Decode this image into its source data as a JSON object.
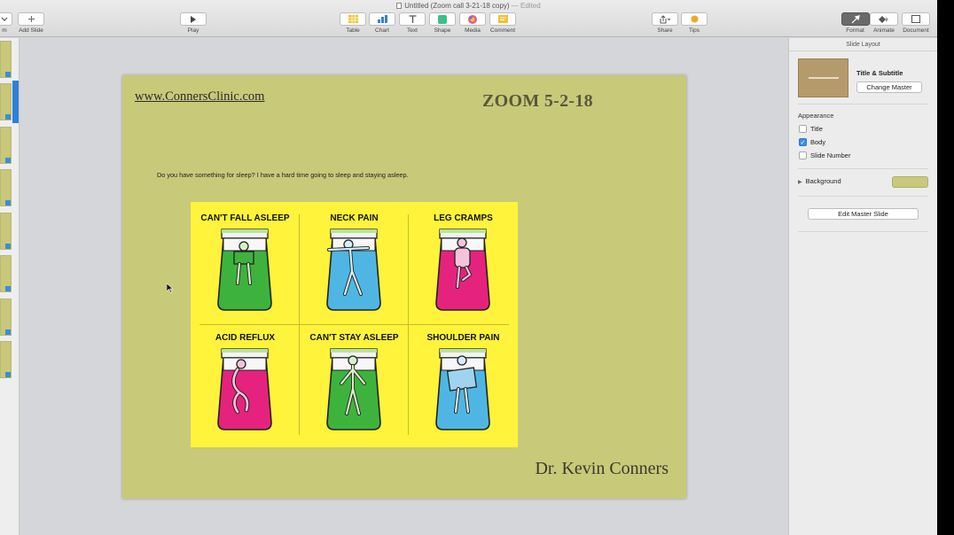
{
  "window": {
    "doc_title": "Untitled (Zoom call 3-21-18 copy)",
    "doc_status": "— Edited"
  },
  "toolbar": {
    "view_label": "m",
    "add_slide_label": "Add Slide",
    "play_label": "Play",
    "table_label": "Table",
    "chart_label": "Chart",
    "text_label": "Text",
    "shape_label": "Shape",
    "media_label": "Media",
    "comment_label": "Comment",
    "share_label": "Share",
    "tips_label": "Tips",
    "format_label": "Format",
    "animate_label": "Animate",
    "document_label": "Document"
  },
  "slide": {
    "link": "www.ConnersClinic.com",
    "title": "ZOOM 5-2-18",
    "body": "Do you have something for sleep? I have a hard time going to sleep and staying asleep.",
    "author": "Dr. Kevin Conners",
    "poster": {
      "cells": [
        {
          "label": "CAN'T FALL ASLEEP",
          "bed_color": "#3db33d"
        },
        {
          "label": "NECK PAIN",
          "bed_color": "#4fb6e4"
        },
        {
          "label": "LEG CRAMPS",
          "bed_color": "#e5237e"
        },
        {
          "label": "ACID REFLUX",
          "bed_color": "#e5237e"
        },
        {
          "label": "CAN'T STAY ASLEEP",
          "bed_color": "#3db33d"
        },
        {
          "label": "SHOULDER PAIN",
          "bed_color": "#4fb6e4"
        }
      ]
    }
  },
  "inspector": {
    "header": "Slide Layout",
    "master_name": "Title & Subtitle",
    "change_master": "Change Master",
    "appearance": "Appearance",
    "options": [
      {
        "label": "Title",
        "checked": false
      },
      {
        "label": "Body",
        "checked": true
      },
      {
        "label": "Slide Number",
        "checked": false
      }
    ],
    "background_label": "Background",
    "background_color": "#c9c97a",
    "edit_master": "Edit Master Slide"
  },
  "colors": {
    "slide_bg": "#c9c97a",
    "poster_bg": "#fff33b",
    "accent": "#2f80d8"
  }
}
